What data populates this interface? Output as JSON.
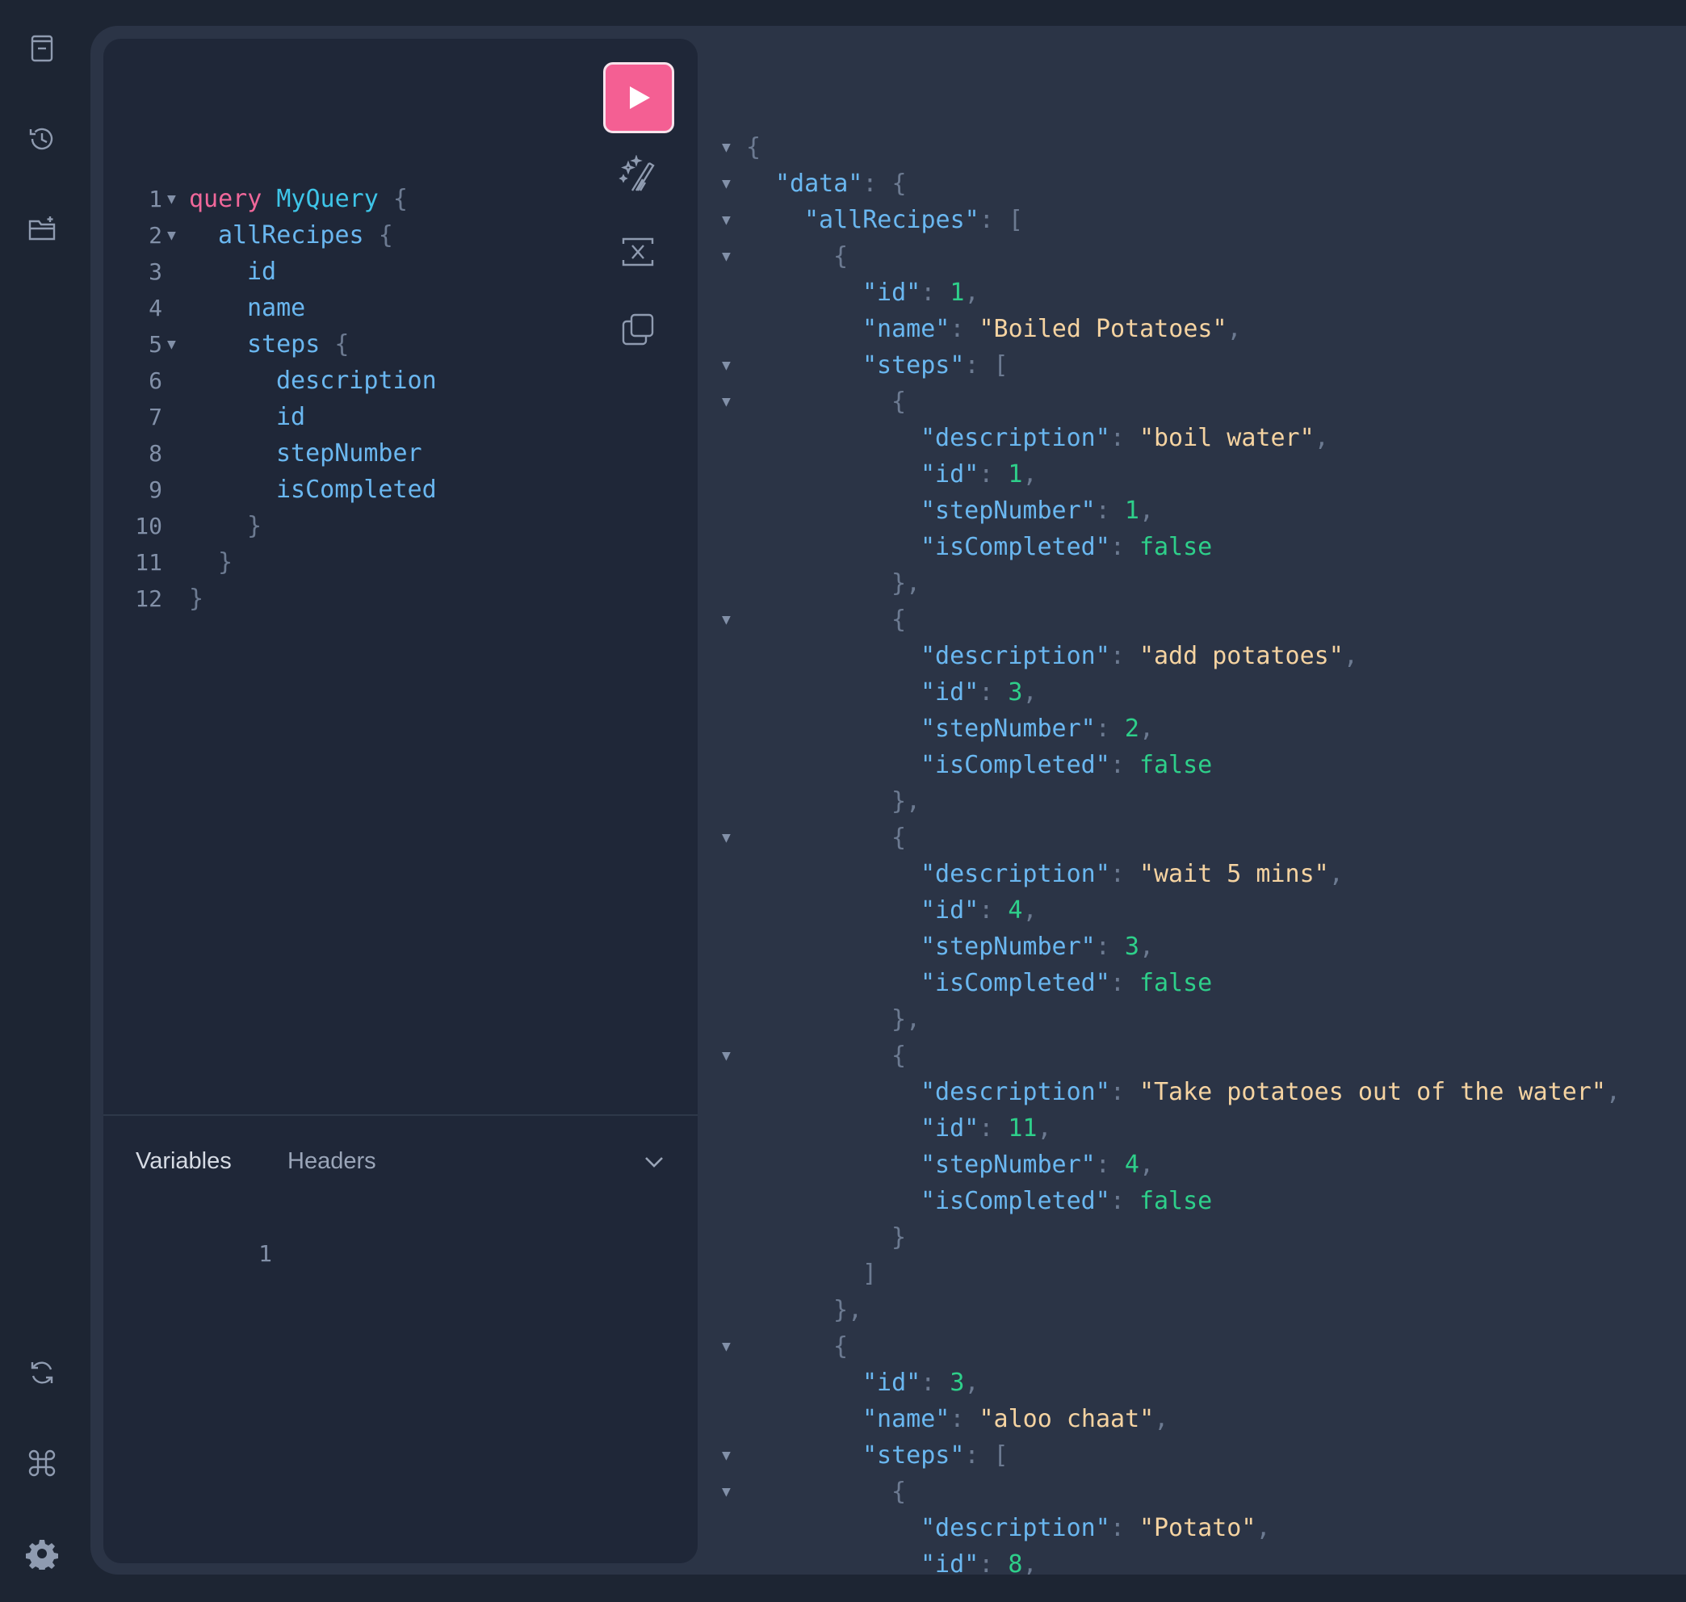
{
  "sidebar": {
    "top_icons": [
      "document-icon",
      "history-icon",
      "new-folder-icon"
    ],
    "bottom_icons": [
      "refresh-icon",
      "command-icon",
      "settings-icon"
    ]
  },
  "editor": {
    "lines": [
      {
        "n": "1",
        "fold": true
      },
      {
        "n": "2",
        "fold": true
      },
      {
        "n": "3",
        "fold": false
      },
      {
        "n": "4",
        "fold": false
      },
      {
        "n": "5",
        "fold": true
      },
      {
        "n": "6",
        "fold": false
      },
      {
        "n": "7",
        "fold": false
      },
      {
        "n": "8",
        "fold": false
      },
      {
        "n": "9",
        "fold": false
      },
      {
        "n": "10",
        "fold": false
      },
      {
        "n": "11",
        "fold": false
      },
      {
        "n": "12",
        "fold": false
      }
    ],
    "tokens": {
      "query_kw": "query",
      "op_name": "MyQuery",
      "all_recipes": "allRecipes",
      "id": "id",
      "name": "name",
      "steps": "steps",
      "description": "description",
      "step_number": "stepNumber",
      "is_completed": "isCompleted"
    }
  },
  "toolbar": {
    "run": "play-icon",
    "prettify": "magic-wand-icon",
    "merge": "merge-fragments-icon",
    "copy": "copy-icon"
  },
  "bottom_tabs": {
    "variables": "Variables",
    "headers": "Headers",
    "variables_line": "1"
  },
  "result": {
    "data_key": "\"data\"",
    "all_recipes_key": "\"allRecipes\"",
    "recipes": [
      {
        "id": "1",
        "name": "\"Boiled Potatoes\"",
        "steps": [
          {
            "description": "\"boil water\"",
            "id": "1",
            "stepNumber": "1",
            "isCompleted": "false"
          },
          {
            "description": "\"add potatoes\"",
            "id": "3",
            "stepNumber": "2",
            "isCompleted": "false"
          },
          {
            "description": "\"wait 5 mins\"",
            "id": "4",
            "stepNumber": "3",
            "isCompleted": "false"
          },
          {
            "description": "\"Take potatoes out of the water\"",
            "id": "11",
            "stepNumber": "4",
            "isCompleted": "false"
          }
        ]
      },
      {
        "id": "3",
        "name": "\"aloo chaat\"",
        "steps": [
          {
            "description": "\"Potato\"",
            "id": "8"
          }
        ]
      }
    ],
    "keys": {
      "id": "\"id\"",
      "name": "\"name\"",
      "steps": "\"steps\"",
      "description": "\"description\"",
      "stepNumber": "\"stepNumber\"",
      "isCompleted": "\"isCompleted\""
    }
  },
  "colors": {
    "background": "#1d2533",
    "panel": "#2b3446",
    "editor": "#1f2738",
    "run_button": "#f45f93",
    "keyword": "#f0679a",
    "field": "#6ab7f0",
    "string": "#f5d3a1",
    "number": "#2ecf8a"
  }
}
